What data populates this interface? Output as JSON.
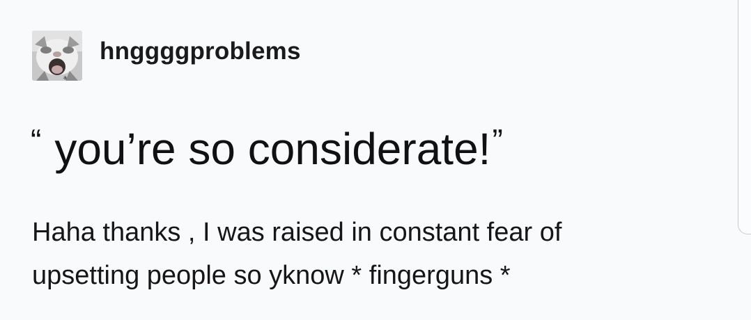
{
  "post": {
    "username": "hnggggproblems",
    "avatar_icon": "cat-avatar-icon",
    "avatar_caption": "a",
    "quote_open": "“",
    "quote_text": "you’re so considerate!",
    "quote_close": "”",
    "reply_line_1": "Haha thanks , I was raised in constant fear of",
    "reply_line_2": "upsetting people so yknow * fingerguns *"
  },
  "colors": {
    "background": "#f9fafc",
    "text": "#111111"
  }
}
